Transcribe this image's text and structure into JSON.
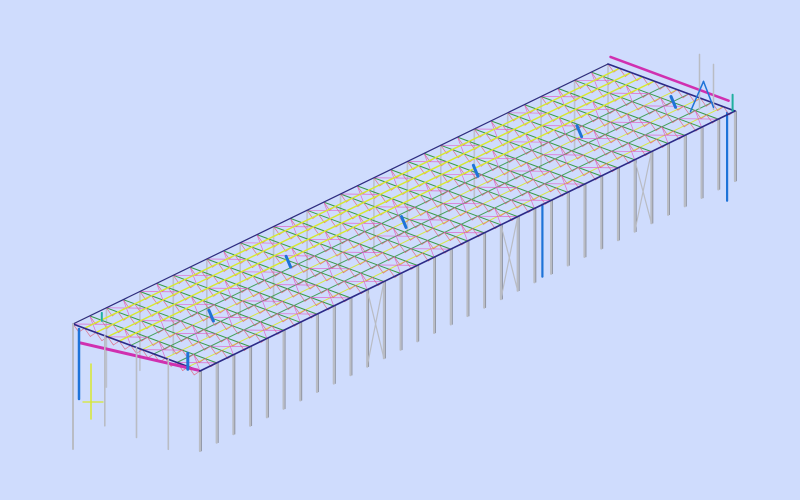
{
  "scene": {
    "background": "#cfdcfd",
    "subject": "steel-frame-building-3d-model",
    "colors": {
      "column": "#b9bcc4",
      "column_shadow": "#7c7f88",
      "eave_beam": "#2c2a88",
      "purlin": "#d8e830",
      "truss_chord": "#3a9a4a",
      "truss_web": "#e0607a",
      "bracing": "#e050c0",
      "brace_blue": "#1e73d8",
      "highlight_beam": "#d030b0",
      "cyan_strut": "#30c8c0",
      "teal_post": "#20b0a0"
    },
    "bays": 32,
    "truss_lines": 11
  }
}
